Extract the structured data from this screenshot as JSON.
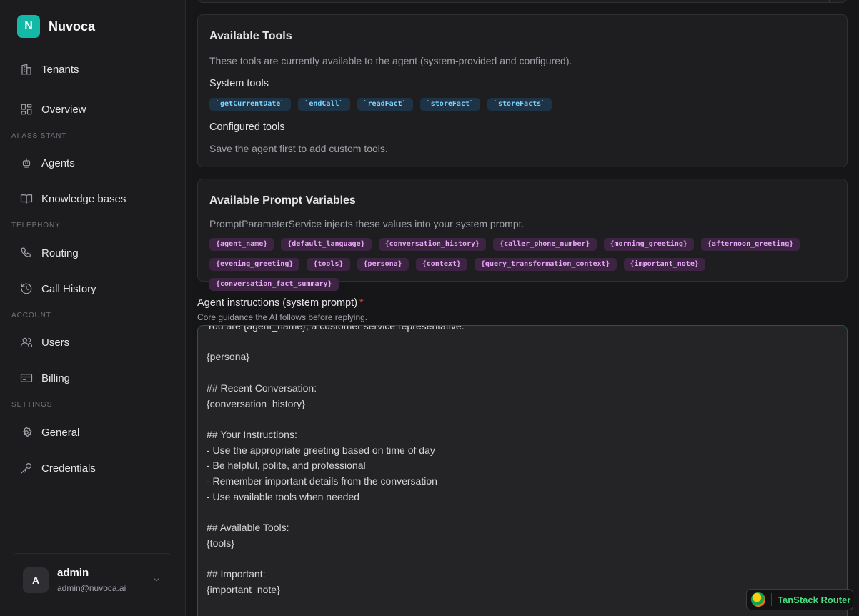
{
  "app": {
    "logo_letter": "N",
    "name": "Nuvoca"
  },
  "sidebar": {
    "top_items": [
      {
        "label": "Tenants",
        "icon": "building-icon"
      },
      {
        "label": "Overview",
        "icon": "dashboard-icon"
      }
    ],
    "sections": [
      {
        "label": "AI ASSISTANT",
        "items": [
          {
            "label": "Agents",
            "icon": "bot-icon"
          },
          {
            "label": "Knowledge bases",
            "icon": "book-icon"
          }
        ]
      },
      {
        "label": "TELEPHONY",
        "items": [
          {
            "label": "Routing",
            "icon": "phone-icon"
          },
          {
            "label": "Call History",
            "icon": "history-icon"
          }
        ]
      },
      {
        "label": "ACCOUNT",
        "items": [
          {
            "label": "Users",
            "icon": "users-icon"
          },
          {
            "label": "Billing",
            "icon": "credit-card-icon"
          }
        ]
      },
      {
        "label": "SETTINGS",
        "items": [
          {
            "label": "General",
            "icon": "gear-icon"
          },
          {
            "label": "Credentials",
            "icon": "key-icon"
          }
        ]
      }
    ],
    "user": {
      "avatar_letter": "A",
      "name": "admin",
      "email": "admin@nuvoca.ai"
    }
  },
  "tools_card": {
    "title": "Available Tools",
    "description": "These tools are currently available to the agent (system-provided and configured).",
    "system_heading": "System tools",
    "system_tools": [
      "`getCurrentDate`",
      "`endCall`",
      "`readFact`",
      "`storeFact`",
      "`storeFacts`"
    ],
    "configured_heading": "Configured tools",
    "configured_note": "Save the agent first to add custom tools."
  },
  "variables_card": {
    "title": "Available Prompt Variables",
    "description": "PromptParameterService injects these values into your system prompt.",
    "variables": [
      "{agent_name}",
      "{default_language}",
      "{conversation_history}",
      "{caller_phone_number}",
      "{morning_greeting}",
      "{afternoon_greeting}",
      "{evening_greeting}",
      "{tools}",
      "{persona}",
      "{context}",
      "{query_transformation_context}",
      "{important_note}",
      "{conversation_fact_summary}"
    ]
  },
  "instructions": {
    "label": "Agent instructions (system prompt)",
    "required_mark": "*",
    "help": "Core guidance the AI follows before replying.",
    "value": "You are {agent_name}, a customer service representative.\n\n{persona}\n\n## Recent Conversation:\n{conversation_history}\n\n## Your Instructions:\n- Use the appropriate greeting based on time of day\n- Be helpful, polite, and professional\n- Remember important details from the conversation\n- Use available tools when needed\n\n## Available Tools:\n{tools}\n\n## Important:\n{important_note}"
  },
  "devtools": {
    "label": "TanStack Router"
  }
}
